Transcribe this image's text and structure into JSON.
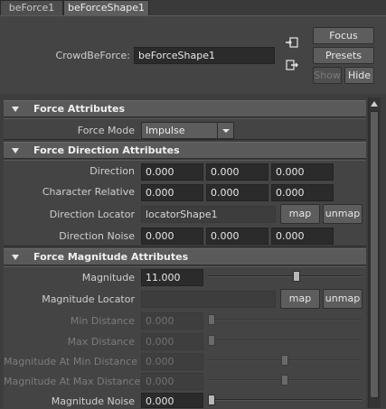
{
  "tabs": [
    {
      "label": "beForce1"
    },
    {
      "label": "beForceShape1"
    }
  ],
  "header": {
    "node_label": "CrowdBeForce:",
    "node_value": "beForceShape1",
    "focus": "Focus",
    "presets": "Presets",
    "show": "Show",
    "hide": "Hide"
  },
  "sections": {
    "force": {
      "title": "Force Attributes",
      "force_mode_label": "Force Mode",
      "force_mode_value": "Impulse"
    },
    "direction": {
      "title": "Force Direction Attributes",
      "direction_label": "Direction",
      "direction_values": [
        "0.000",
        "0.000",
        "0.000"
      ],
      "character_relative_label": "Character Relative",
      "character_relative_values": [
        "0.000",
        "0.000",
        "0.000"
      ],
      "direction_locator_label": "Direction Locator",
      "direction_locator_value": "locatorShape1",
      "map": "map",
      "unmap": "unmap",
      "direction_noise_label": "Direction Noise",
      "direction_noise_values": [
        "0.000",
        "0.000",
        "0.000"
      ]
    },
    "magnitude": {
      "title": "Force Magnitude Attributes",
      "magnitude_label": "Magnitude",
      "magnitude_value": "11.000",
      "magnitude_locator_label": "Magnitude Locator",
      "magnitude_locator_value": "",
      "map": "map",
      "unmap": "unmap",
      "min_distance_label": "Min Distance",
      "min_distance_value": "0.000",
      "max_distance_label": "Max Distance",
      "max_distance_value": "0.000",
      "mag_at_min_label": "Magnitude At Min Distance",
      "mag_at_min_value": "0.000",
      "mag_at_max_label": "Magnitude At Max Distance",
      "mag_at_max_value": "0.000",
      "magnitude_noise_label": "Magnitude Noise",
      "magnitude_noise_value": "0.000"
    }
  },
  "sliders": {
    "magnitude": 0.58,
    "min_distance": 0.0,
    "max_distance": 0.0,
    "mag_at_min": 0.5,
    "mag_at_max": 0.5,
    "magnitude_noise": 0.0
  }
}
